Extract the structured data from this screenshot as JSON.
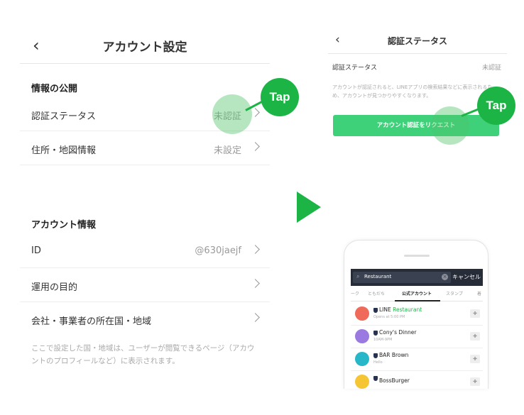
{
  "left_screen": {
    "back_icon": "chevron-left-icon",
    "title": "アカウント設定",
    "section_public": {
      "title": "情報の公開",
      "rows": [
        {
          "label": "認証ステータス",
          "value": "未認証"
        },
        {
          "label": "住所・地図情報",
          "value": "未設定"
        }
      ]
    },
    "section_account": {
      "title": "アカウント情報",
      "rows": [
        {
          "label": "ID",
          "value": "@630jaejf"
        },
        {
          "label": "運用の目的",
          "value": ""
        },
        {
          "label": "会社・事業者の所在国・地域",
          "value": ""
        }
      ]
    },
    "note": "ここで設定した国・地域は、ユーザーが閲覧できるページ（アカウントのプロフィールなど）に表示されます。",
    "tap_label": "Tap"
  },
  "right_screen": {
    "back_icon": "chevron-left-icon",
    "title": "認証ステータス",
    "status_label": "認証ステータス",
    "status_value": "未認証",
    "description": "アカウントが認証されると、LINEアプリの検索結果などに表示されるため、アカウントが見つかりやすくなります。",
    "request_button": "アカウント認証をリクエスト",
    "tap_label": "Tap"
  },
  "phone": {
    "search_text": "Restaurant",
    "cancel": "キャンセル",
    "tabs": [
      "ーク",
      "ともだち",
      "公式アカウント",
      "スタンプ",
      "着"
    ],
    "results": [
      {
        "name_prefix": "LINE ",
        "name_highlight": "Restaurant",
        "sub": "Opens at 5:00 PM",
        "avatar_color": "#f06a5a"
      },
      {
        "name_prefix": "Cony's Dinner",
        "name_highlight": "",
        "sub": "10AM-9PM",
        "avatar_color": "#9a7ae0"
      },
      {
        "name_prefix": "BAR Brown",
        "name_highlight": "",
        "sub": "Hello",
        "avatar_color": "#28b7c9"
      },
      {
        "name_prefix": "BossBurger",
        "name_highlight": "",
        "sub": "",
        "avatar_color": "#f5c534"
      }
    ]
  },
  "colors": {
    "accent_green": "#1db446",
    "button_green": "#3ed17a"
  }
}
